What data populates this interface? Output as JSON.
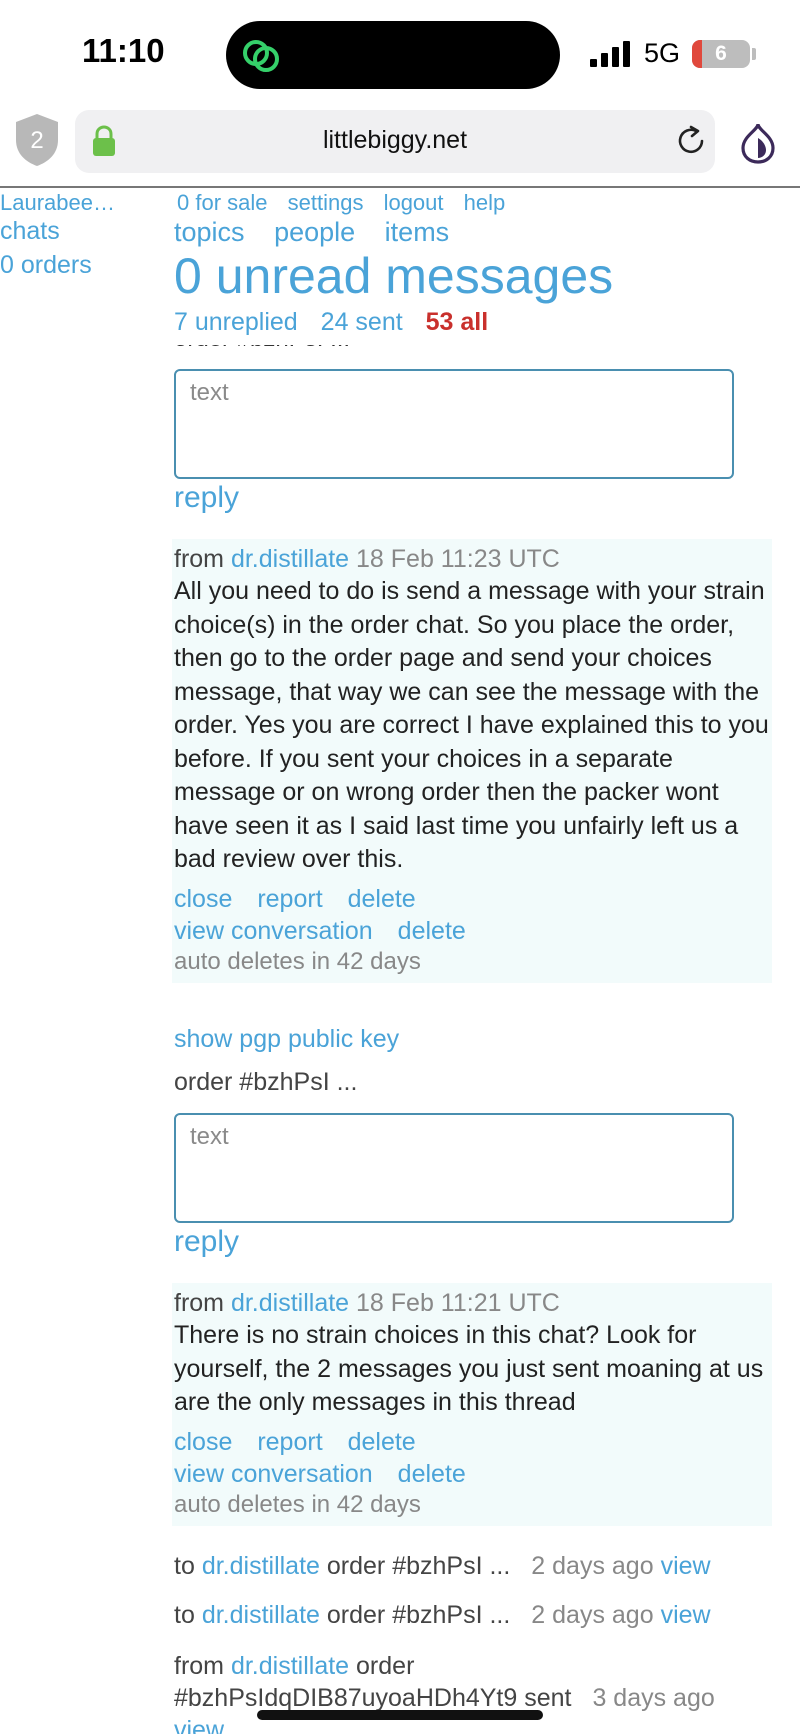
{
  "status_bar": {
    "time": "11:10",
    "network": "5G",
    "battery_level": "6",
    "battery_fraction": 0.06,
    "island_icon": "linked-rings-icon"
  },
  "browser": {
    "shield_count": "2",
    "url": "littlebiggy.net",
    "icons": [
      "shield-icon",
      "lock-icon",
      "reload-icon",
      "onion-icon"
    ]
  },
  "nav": {
    "username": "Laurabee…",
    "chats": "chats",
    "orders": "0 orders"
  },
  "top_links": {
    "for_sale": "0 for sale",
    "settings": "settings",
    "logout": "logout",
    "help": "help"
  },
  "tabs": {
    "topics": "topics",
    "people": "people",
    "items": "items"
  },
  "page_title": "0 unread messages",
  "filters": {
    "unreplied": "7 unreplied",
    "sent": "24 sent",
    "all": "53 all"
  },
  "thread1": {
    "cut_order_label": "order #bzhPsI ...",
    "textbox_placeholder": "text",
    "reply_label": "reply"
  },
  "message1": {
    "from_label": "from",
    "user": "dr.distillate",
    "date": "18 Feb 11:23 UTC",
    "body": "All you need to do is send a message with your strain choice(s) in the order chat. So you place the order, then go to the order page and send your choices message, that way we can see the message with the order. Yes you are correct I have explained this to you before. If you sent your choices in a separate message or on wrong order then the packer wont have seen it as I said last time you unfairly left us a bad review over this.",
    "close": "close",
    "report": "report",
    "delete": "delete",
    "view_conversation": "view conversation",
    "delete2": "delete",
    "auto_delete": "auto deletes in 42 days"
  },
  "pgp_link": "show pgp public key",
  "thread2": {
    "order_label": "order #bzhPsI ...",
    "textbox_placeholder": "text",
    "reply_label": "reply"
  },
  "message2": {
    "from_label": "from",
    "user": "dr.distillate",
    "date": "18 Feb 11:21 UTC",
    "body": "There is no strain choices in this chat? Look for yourself, the 2 messages you just sent moaning at us are the only messages in this thread",
    "close": "close",
    "report": "report",
    "delete": "delete",
    "view_conversation": "view conversation",
    "delete2": "delete",
    "auto_delete": "auto deletes in 42 days"
  },
  "list": [
    {
      "prefix": "to",
      "user": "dr.distillate",
      "order": "order #bzhPsI ...",
      "ago": "2 days ago",
      "view": "view"
    },
    {
      "prefix": "to",
      "user": "dr.distillate",
      "order": "order #bzhPsI ...",
      "ago": "2 days ago",
      "view": "view"
    }
  ],
  "list_last": {
    "prefix": "from",
    "user": "dr.distillate",
    "order_word": "order",
    "order_id": "#bzhPsIdqDIB87uyoaHDh4Yt9",
    "sent": "sent",
    "ago": "3 days ago",
    "view": "view"
  }
}
